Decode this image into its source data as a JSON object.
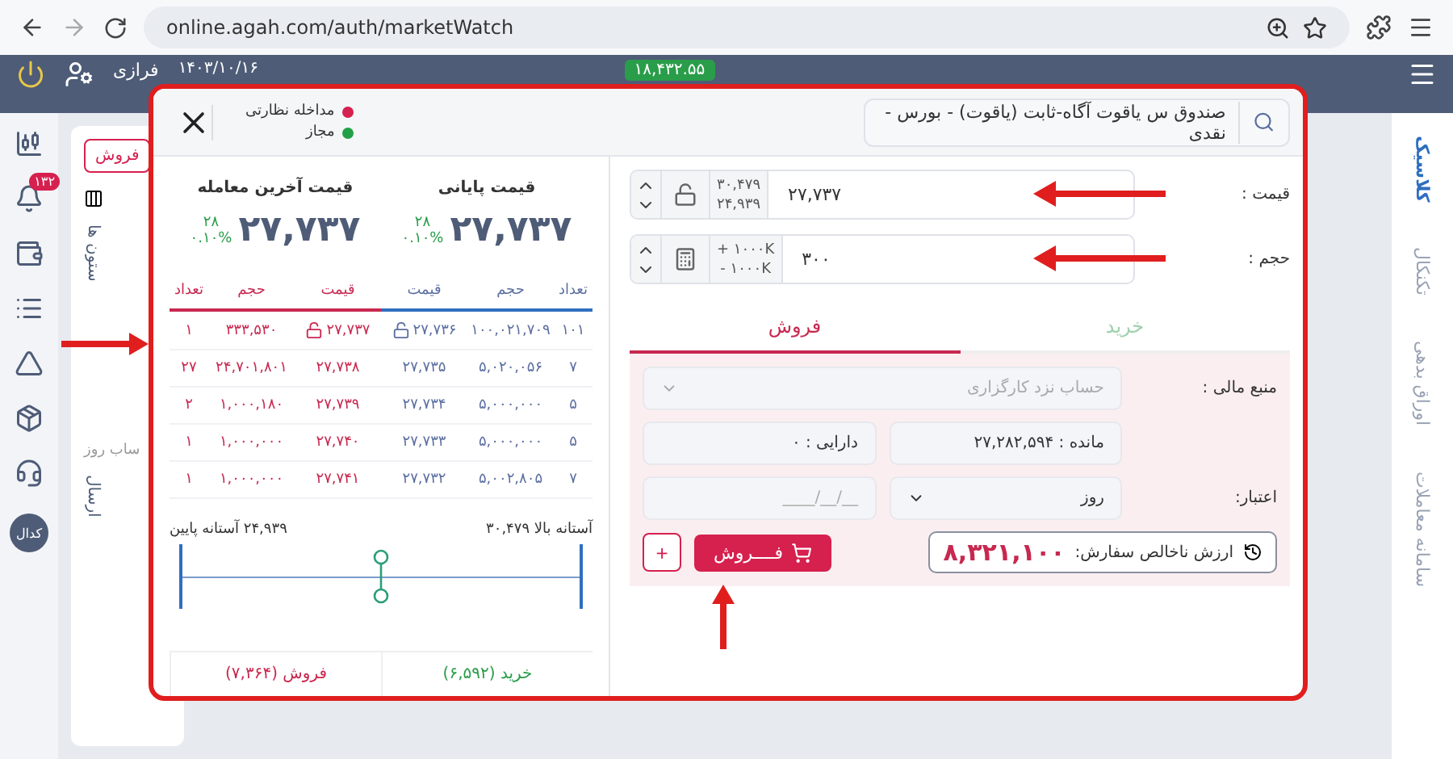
{
  "browser": {
    "url": "online.agah.com/auth/marketWatch"
  },
  "app_header": {
    "user_name": "فرازی",
    "date": "۱۴۰۳/۱۰/۱۶",
    "index_value": "۱۸,۴۳۲.۵۵"
  },
  "left_rail": {
    "notification_badge": "۱۳۲",
    "codal_label": "کدال"
  },
  "right_rail": {
    "tabs": [
      {
        "label": "کلاسیک",
        "selected": true
      },
      {
        "label": "تکنکال",
        "selected": false
      },
      {
        "label": "اوراق بدهی",
        "selected": false
      },
      {
        "label": "سامانه معاملات",
        "selected": false
      }
    ]
  },
  "background": {
    "sell_button": "فروش",
    "column_label": "ستون ها",
    "day_label": "ساب روز",
    "export_label": "ارسال"
  },
  "modal": {
    "search": {
      "value": "صندوق س یاقوت آگاه-ثابت (یاقوت) - بورس - نقدی"
    },
    "legend": [
      {
        "label": "مداخله نظارتی",
        "color": "#d6204e"
      },
      {
        "label": "مجاز",
        "color": "#22a045"
      }
    ],
    "summary": [
      {
        "title": "قیمت پایانی",
        "value": "۲۷,۷۳۷",
        "change": "۲۸",
        "percent": "۰.۱۰%"
      },
      {
        "title": "قیمت آخرین معامله",
        "value": "۲۷,۷۳۷",
        "change": "۲۸",
        "percent": "۰.۱۰%"
      }
    ],
    "order_book": {
      "buy_columns": [
        "تعداد",
        "حجم",
        "قیمت"
      ],
      "sell_columns": [
        "قیمت",
        "حجم",
        "تعداد"
      ],
      "rows": [
        {
          "buy_count": "۱۰۱",
          "buy_volume": "۱۰۰,۰۲۱,۷۰۹",
          "buy_price": "۲۷,۷۳۶",
          "sell_price": "۲۷,۷۳۷",
          "sell_volume": "۳۳۳,۵۳۰",
          "sell_count": "۱",
          "locked": true
        },
        {
          "buy_count": "۷",
          "buy_volume": "۵,۰۲۰,۰۵۶",
          "buy_price": "۲۷,۷۳۵",
          "sell_price": "۲۷,۷۳۸",
          "sell_volume": "۲۴,۷۰۱,۸۰۱",
          "sell_count": "۲۷",
          "locked": false
        },
        {
          "buy_count": "۵",
          "buy_volume": "۵,۰۰۰,۰۰۰",
          "buy_price": "۲۷,۷۳۴",
          "sell_price": "۲۷,۷۳۹",
          "sell_volume": "۱,۰۰۰,۱۸۰",
          "sell_count": "۲",
          "locked": false
        },
        {
          "buy_count": "۵",
          "buy_volume": "۵,۰۰۰,۰۰۰",
          "buy_price": "۲۷,۷۳۳",
          "sell_price": "۲۷,۷۴۰",
          "sell_volume": "۱,۰۰۰,۰۰۰",
          "sell_count": "۱",
          "locked": false
        },
        {
          "buy_count": "۷",
          "buy_volume": "۵,۰۰۲,۸۰۵",
          "buy_price": "۲۷,۷۳۲",
          "sell_price": "۲۷,۷۴۱",
          "sell_volume": "۱,۰۰۰,۰۰۰",
          "sell_count": "۱",
          "locked": false
        }
      ],
      "threshold_upper": "آستانه بالا ۳۰,۴۷۹",
      "threshold_lower": "۲۴,۹۳۹ آستانه پایین",
      "threshold": {
        "level": 0.5
      },
      "buy_total": "خرید (۶,۵۹۲)",
      "sell_total": "فروش (۷,۳۶۴)"
    },
    "form": {
      "price": {
        "label": "قیمت :",
        "value": "۲۷,۷۳۷",
        "upper": "۳۰,۴۷۹",
        "lower": "۲۴,۹۳۹"
      },
      "volume": {
        "label": "حجم :",
        "value": "۳۰۰",
        "plus": "+ ۱۰۰۰K",
        "minus": "- ۱۰۰۰K"
      },
      "tabs": [
        {
          "label": "خرید",
          "kind": "buy",
          "selected": false
        },
        {
          "label": "فروش",
          "kind": "sell",
          "selected": true
        }
      ],
      "funding": {
        "label": "منبع مالی :",
        "placeholder": "حساب نزد کارگزاری",
        "disabled": true
      },
      "remaining": "مانده : ۲۷,۲۸۲,۵۹۴",
      "assets": "دارایی : ۰",
      "validity": {
        "label": "اعتبار:",
        "value": "روز",
        "date_placeholder": "__/__/____"
      },
      "order_value": {
        "label": "ارزش ناخالص سفارش:",
        "value": "۸,۳۲۱,۱۰۰"
      },
      "submit": "فــــروش",
      "add": "+"
    }
  }
}
